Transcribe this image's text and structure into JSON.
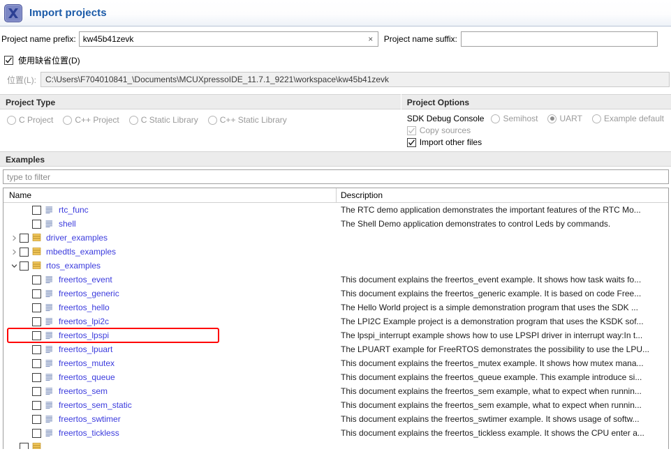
{
  "window": {
    "title": "Import projects",
    "icon": "mcuxpresso-x-icon"
  },
  "form": {
    "prefix_label": "Project name prefix:",
    "prefix_value": "kw45b41zevk",
    "prefix_clear": "×",
    "suffix_label": "Project name suffix:",
    "suffix_value": "",
    "default_location_label": "使用缺省位置(D)",
    "default_location_checked": true,
    "location_label": "位置(L):",
    "location_value": "C:\\Users\\F704010841_\\Documents\\MCUXpressoIDE_11.7.1_9221\\workspace\\kw45b41zevk"
  },
  "project_type": {
    "header": "Project Type",
    "options": [
      {
        "label": "C Project",
        "selected": false
      },
      {
        "label": "C++ Project",
        "selected": false
      },
      {
        "label": "C Static Library",
        "selected": false
      },
      {
        "label": "C++ Static Library",
        "selected": false
      }
    ]
  },
  "project_options": {
    "header": "Project Options",
    "console_label": "SDK Debug Console",
    "console_options": [
      {
        "label": "Semihost",
        "selected": false
      },
      {
        "label": "UART",
        "selected": true
      },
      {
        "label": "Example default",
        "selected": false
      }
    ],
    "checkboxes": [
      {
        "label": "Copy sources",
        "checked": true,
        "disabled": true
      },
      {
        "label": "Import other files",
        "checked": true,
        "disabled": false
      }
    ]
  },
  "examples": {
    "header": "Examples",
    "filter_placeholder": "type to filter",
    "filter_value": "",
    "columns": [
      "Name",
      "Description"
    ],
    "highlighted_row": "freertos_lpspi",
    "rows": [
      {
        "name": "rtc_func",
        "indent": 2,
        "icon": "document-icon",
        "twisty": "none",
        "checked": false,
        "description": "The RTC demo application demonstrates the important features of the RTC Mo..."
      },
      {
        "name": "shell",
        "indent": 2,
        "icon": "document-icon",
        "twisty": "none",
        "checked": false,
        "description": "The Shell Demo application demonstrates to control Leds by commands."
      },
      {
        "name": "driver_examples",
        "indent": 1,
        "icon": "folder-icon",
        "twisty": "collapsed",
        "checked": false,
        "description": ""
      },
      {
        "name": "mbedtls_examples",
        "indent": 1,
        "icon": "folder-icon",
        "twisty": "collapsed",
        "checked": false,
        "description": ""
      },
      {
        "name": "rtos_examples",
        "indent": 1,
        "icon": "folder-icon",
        "twisty": "expanded",
        "checked": false,
        "description": ""
      },
      {
        "name": "freertos_event",
        "indent": 2,
        "icon": "document-icon",
        "twisty": "none",
        "checked": false,
        "description": "This document explains the freertos_event example. It shows how task waits fo..."
      },
      {
        "name": "freertos_generic",
        "indent": 2,
        "icon": "document-icon",
        "twisty": "none",
        "checked": false,
        "description": "This document explains the freertos_generic example. It is based on code Free..."
      },
      {
        "name": "freertos_hello",
        "indent": 2,
        "icon": "document-icon",
        "twisty": "none",
        "checked": false,
        "description": "The Hello World project is a simple demonstration program that uses the SDK ..."
      },
      {
        "name": "freertos_lpi2c",
        "indent": 2,
        "icon": "document-icon",
        "twisty": "none",
        "checked": false,
        "description": "The LPI2C Example project is a demonstration program that uses the KSDK sof..."
      },
      {
        "name": "freertos_lpspi",
        "indent": 2,
        "icon": "document-icon",
        "twisty": "none",
        "checked": false,
        "description": "The lpspi_interrupt example shows how to use LPSPI driver in interrupt way:In t..."
      },
      {
        "name": "freertos_lpuart",
        "indent": 2,
        "icon": "document-icon",
        "twisty": "none",
        "checked": false,
        "description": "The LPUART example for FreeRTOS demonstrates the possibility to use the LPU..."
      },
      {
        "name": "freertos_mutex",
        "indent": 2,
        "icon": "document-icon",
        "twisty": "none",
        "checked": false,
        "description": "This document explains the freertos_mutex example. It shows how mutex mana..."
      },
      {
        "name": "freertos_queue",
        "indent": 2,
        "icon": "document-icon",
        "twisty": "none",
        "checked": false,
        "description": "This document explains the freertos_queue example. This example introduce si..."
      },
      {
        "name": "freertos_sem",
        "indent": 2,
        "icon": "document-icon",
        "twisty": "none",
        "checked": false,
        "description": "This document explains the freertos_sem example, what to expect when runnin..."
      },
      {
        "name": "freertos_sem_static",
        "indent": 2,
        "icon": "document-icon",
        "twisty": "none",
        "checked": false,
        "description": "This document explains the freertos_sem example, what to expect when runnin..."
      },
      {
        "name": "freertos_swtimer",
        "indent": 2,
        "icon": "document-icon",
        "twisty": "none",
        "checked": false,
        "description": "This document explains the freertos_swtimer example. It shows usage of softw..."
      },
      {
        "name": "freertos_tickless",
        "indent": 2,
        "icon": "document-icon",
        "twisty": "none",
        "checked": false,
        "description": "This document explains the freertos_tickless example. It shows the CPU enter a..."
      },
      {
        "name": "",
        "indent": 1,
        "icon": "folder-icon",
        "twisty": "none",
        "checked": false,
        "description": ""
      }
    ]
  },
  "colors": {
    "accent": "#1a5aa8",
    "node_text": "#3b3bdd",
    "highlight": "#ff0000",
    "header_bg": "#ececec"
  }
}
